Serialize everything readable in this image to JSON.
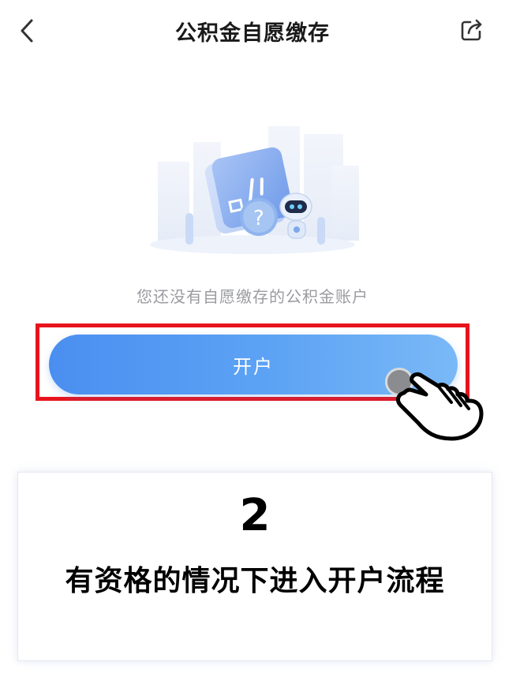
{
  "header": {
    "title": "公积金自愿缴存",
    "back_icon": "chevron-left-icon",
    "share_icon": "share-icon"
  },
  "empty_state": {
    "illustration": "empty-account-illustration",
    "message": "您还没有自愿缴存的公积金账户"
  },
  "action": {
    "open_account_label": "开户"
  },
  "annotation": {
    "highlight_color": "#e8141c",
    "step_number": "2",
    "step_text": "有资格的情况下进入开户流程"
  },
  "colors": {
    "button_start": "#4a8ff0",
    "button_end": "#7ab9f7",
    "empty_text": "#9a9ba0"
  }
}
